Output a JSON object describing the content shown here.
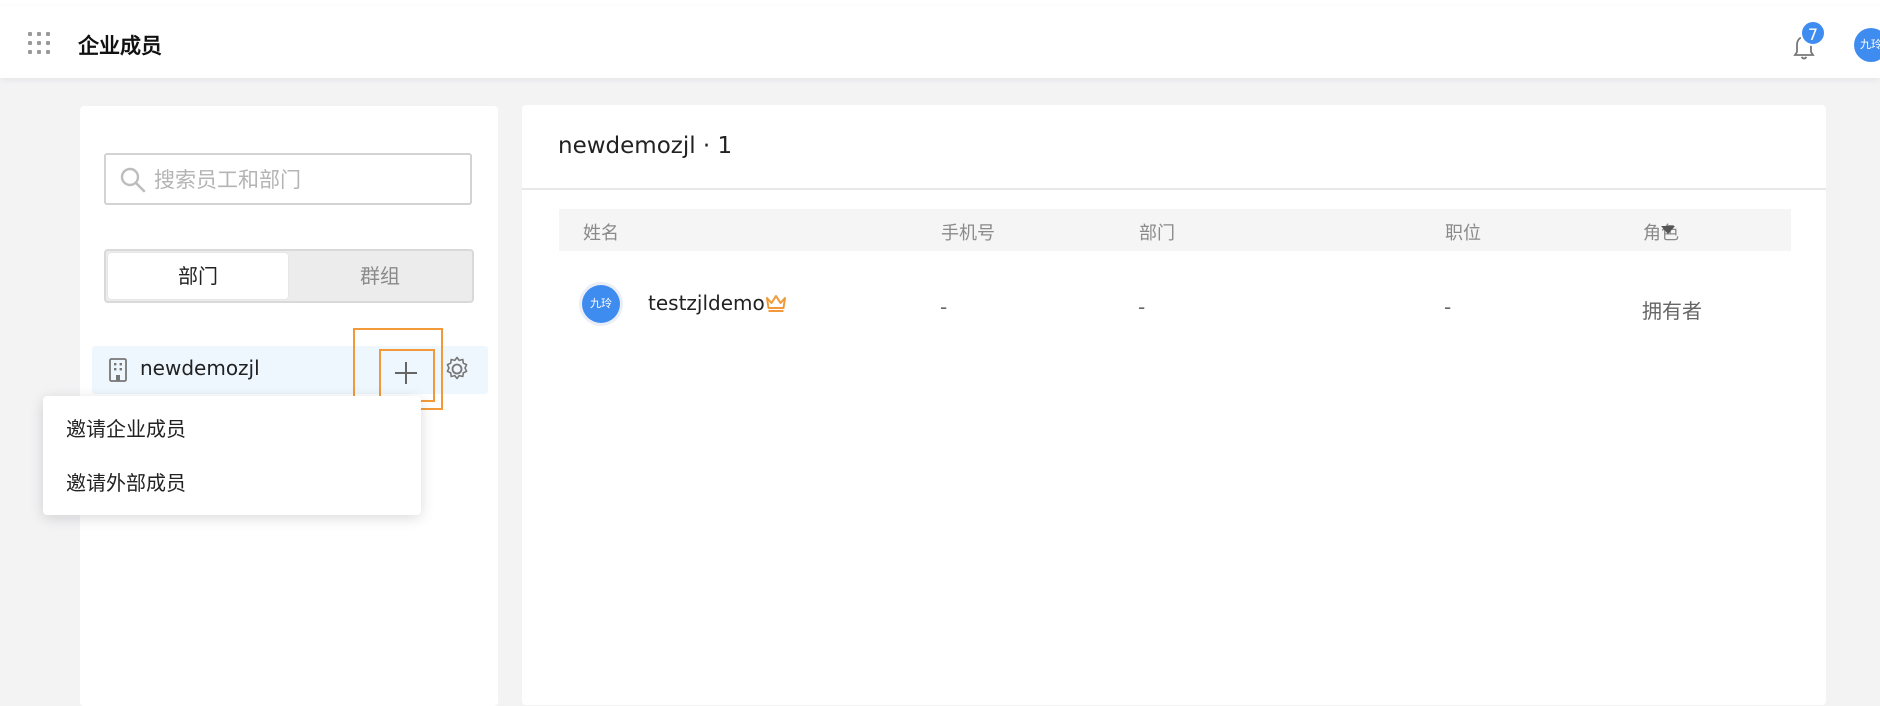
{
  "header": {
    "title": "企业成员",
    "notification_count": "7",
    "avatar_text": "九玲"
  },
  "sidebar": {
    "search_placeholder": "搜索员工和部门",
    "tabs": [
      "部门",
      "群组"
    ],
    "active_tab": "部门",
    "department": "newdemozjl"
  },
  "dropdown": {
    "items": [
      "邀请企业成员",
      "邀请外部成员"
    ]
  },
  "main": {
    "title": "newdemozjl · 1",
    "columns": [
      "姓名",
      "手机号",
      "部门",
      "职位",
      "角色"
    ],
    "rows": [
      {
        "avatar": "九玲",
        "name": "testzjldemo",
        "phone": "-",
        "department": "-",
        "position": "-",
        "role": "拥有者"
      }
    ]
  },
  "colors": {
    "accent_blue": "#3f8cf0",
    "highlight_orange": "#f29a3a",
    "selected_row_bg": "#eef6fe"
  }
}
